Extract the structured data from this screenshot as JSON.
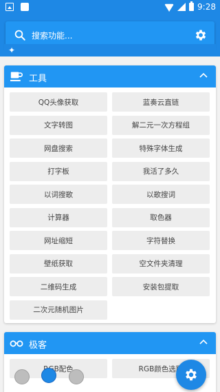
{
  "status_bar": {
    "time": "9:28"
  },
  "search": {
    "placeholder": "搜索功能..."
  },
  "tools_section": {
    "title": "工具",
    "items": [
      "QQ头像获取",
      "蓝奏云直链",
      "文字转图",
      "解二元一次方程组",
      "网盘搜索",
      "特殊字体生成",
      "打字板",
      "我活了多久",
      "以词搜歌",
      "以歌搜词",
      "计算器",
      "取色器",
      "网址缩短",
      "字符替换",
      "壁纸获取",
      "空文件夹清理",
      "二维码生成",
      "安装包提取",
      "二次元随机图片"
    ]
  },
  "geek_section": {
    "title": "极客",
    "items": [
      "RGB配色",
      "RGB颜色选取"
    ]
  },
  "colors": {
    "primary": "#1e88e5",
    "header": "#2196f3"
  }
}
